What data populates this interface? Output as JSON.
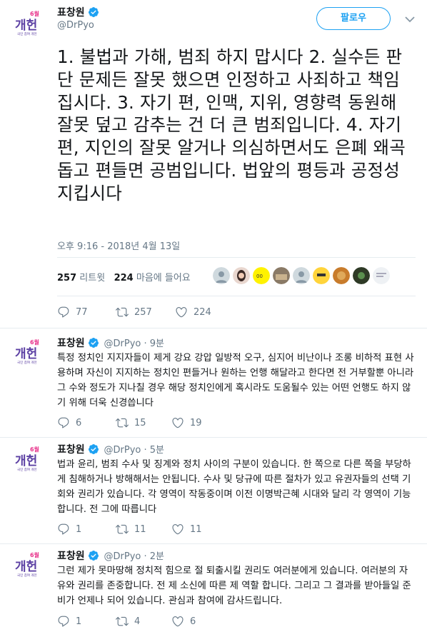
{
  "main_tweet": {
    "display_name": "표창원",
    "handle": "@DrPyo",
    "follow_label": "팔로우",
    "text": "1. 불법과 가해, 범죄 하지 맙시다 2. 실수든 판단 문제든 잘못 했으면 인정하고 사죄하고 책임집시다. 3. 자기 편, 인맥, 지위, 영향력 동원해 잘못 덮고 감추는 건 더 큰 범죄입니다. 4. 자기 편, 지인의 잘못 알거나 의심하면서도 은폐 왜곡 돕고 편들면 공범입니다. 법앞의 평등과 공정성 지킵시다",
    "timestamp": "오후 9:16 - 2018년 4월 13일",
    "retweet_count": "257",
    "retweet_label": "리트윗",
    "like_count": "224",
    "like_label": "마음에 들어요",
    "actions": {
      "reply": "77",
      "retweet": "257",
      "like": "224"
    }
  },
  "avatar_text": {
    "top": "6월",
    "main": "개헌",
    "sub": "국민 참여 개헌"
  },
  "replies": [
    {
      "display_name": "표창원",
      "handle_time": "@DrPyo · 9분",
      "text": "특정 정치인 지지자들이 제게 강요 강압 일방적 오구, 심지어 비난이나 조롱 비하적 표현 사용하며 자신이 지지하는 정치인 편들거나 원하는 언행 해달라고 한다면 전 거부할뿐 아니라 그 수와 정도가 지나칠 경우 해당 정치인에게 혹시라도 도움될수 있는 어떤 언행도 하지 않기 위해 더욱 신경씁니다",
      "reply": "6",
      "retweet": "15",
      "like": "19"
    },
    {
      "display_name": "표창원",
      "handle_time": "@DrPyo · 5분",
      "text": "법과 윤리, 범죄 수사 및 징계와 정치 사이의 구분이 있습니다. 한 쪽으로 다른 쪽을 부당하게 침해하거나 방해해서는 안됩니다. 수사 및 당규에 따른 절차가 있고 유권자들의 선택 기회와 권리가 있습니다. 각 영역이 작동중이며 이전 이명박근혜 시대와 달리 각 영역이 기능합니다. 전 그에 따릅니다",
      "reply": "1",
      "retweet": "11",
      "like": "11"
    },
    {
      "display_name": "표창원",
      "handle_time": "@DrPyo · 2분",
      "text": "그런 제가 못마땅해 정치적 힘으로 절 퇴출시킬 권리도 여러분에게 있습니다. 여러분의 자유와 권리를 존중합니다. 전 제 소신에 따른 제 역할 합니다. 그리고 그 결과를 받아들일 준비가 언제나 되어 있습니다. 관심과 참여에 감사드립니다.",
      "reply": "1",
      "retweet": "4",
      "like": "6"
    }
  ],
  "colors": {
    "accent": "#1da1f2",
    "muted": "#657786",
    "divider": "#e6ecf0",
    "avatar_purple": "#5b3fa3",
    "avatar_pink": "#e8338b"
  },
  "icons": [
    "verified-badge-icon",
    "chevron-down-icon",
    "reply-icon",
    "retweet-icon",
    "like-icon"
  ]
}
